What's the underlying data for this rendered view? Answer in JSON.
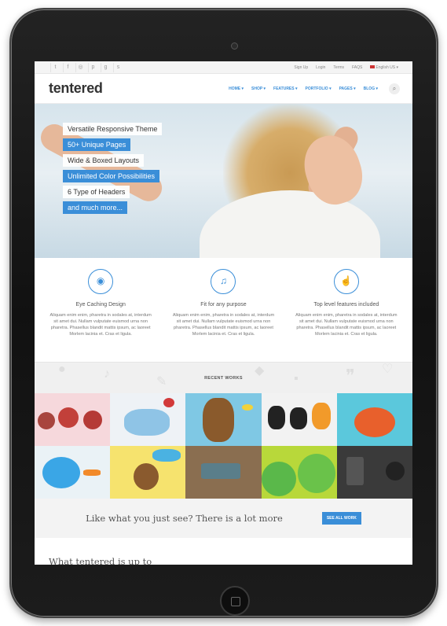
{
  "topbar": {
    "social_icons": [
      "twitter-icon",
      "facebook-icon",
      "github-icon",
      "pinterest-icon",
      "google-plus-icon",
      "skype-icon"
    ],
    "links": {
      "signup": "Sign Up",
      "login": "Login",
      "terms": "Terms",
      "faqs": "FAQS",
      "language": "English US"
    }
  },
  "header": {
    "logo": "tentered",
    "nav": [
      "HOME",
      "SHOP",
      "FEATURES",
      "PORTFOLIO",
      "PAGES",
      "BLOG"
    ]
  },
  "hero": {
    "tags": [
      {
        "text": "Versatile Responsive Theme",
        "style": "light"
      },
      {
        "text": "50+ Unique Pages",
        "style": "blue"
      },
      {
        "text": "Wide & Boxed Layouts",
        "style": "light"
      },
      {
        "text": "Unlimited Color Possibilities",
        "style": "blue"
      },
      {
        "text": "6 Type of Headers",
        "style": "light"
      },
      {
        "text": "and much more...",
        "style": "blue"
      }
    ]
  },
  "features": [
    {
      "icon": "eye-icon",
      "title": "Eye Caching Design",
      "text": "Aliquam enim enim, pharetra in sodales at, interdum sit amet dui. Nullam vulputate euismod urna non pharetra. Phasellus blandit mattis ipsum, ac laoreet Morlem lacinia et. Cras et ligula."
    },
    {
      "icon": "headphones-icon",
      "title": "Fit for any purpose",
      "text": "Aliquam enim enim, pharetra in sodales at, interdum sit amet dui. Nullam vulputate euismod urna non pharetra. Phasellus blandit mattis ipsum, ac laoreet Morlem lacinia et. Cras et ligula."
    },
    {
      "icon": "thumbs-up-icon",
      "title": "Top level features included",
      "text": "Aliquam enim enim, pharetra in sodales at, interdum sit amet dui. Nullam vulputate euismod urna non pharetra. Phasellus blandit mattis ipsum, ac laoreet Morlem lacinia et. Cras et ligula."
    }
  ],
  "recent_works": {
    "title": "RECENT WORKS"
  },
  "cta": {
    "text": "Like what you just see? There is a lot more",
    "button": "SEE ALL WORK"
  },
  "section": {
    "title": "What tentered is up to"
  },
  "colors": {
    "accent": "#3a8ed8",
    "frame": "#1a1a1a"
  }
}
